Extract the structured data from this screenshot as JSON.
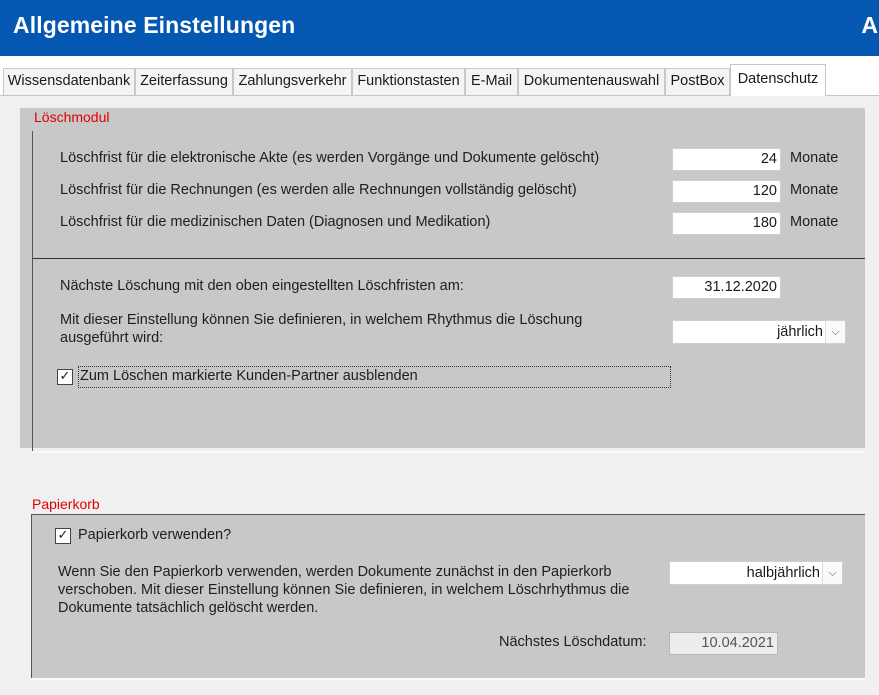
{
  "window": {
    "title": "Allgemeine Einstellungen",
    "title_edge": "A"
  },
  "tabs": [
    {
      "label": "Wissensdatenbank"
    },
    {
      "label": "Zeiterfassung"
    },
    {
      "label": "Zahlungsverkehr"
    },
    {
      "label": "Funktionstasten"
    },
    {
      "label": "E-Mail"
    },
    {
      "label": "Dokumentenauswahl"
    },
    {
      "label": "PostBox"
    },
    {
      "label": "Datenschutz",
      "active": true
    }
  ],
  "loeschmodul": {
    "title": "Löschmodul",
    "rows": [
      {
        "label": "Löschfrist für die elektronische Akte (es werden Vorgänge und Dokumente gelöscht)",
        "value": "24",
        "unit": "Monate"
      },
      {
        "label": "Löschfrist für die Rechnungen (es werden alle Rechnungen vollständig gelöscht)",
        "value": "120",
        "unit": "Monate"
      },
      {
        "label": "Löschfrist für die medizinischen Daten (Diagnosen und Medikation)",
        "value": "180",
        "unit": "Monate"
      }
    ],
    "next_label": "Nächste Löschung mit den oben eingestellten Löschfristen am:",
    "next_date": "31.12.2020",
    "rhythm_label": "Mit dieser Einstellung können Sie definieren, in welchem Rhythmus die Löschung ausgeführt wird:",
    "rhythm_value": "jährlich",
    "hide_label": "Zum Löschen markierte Kunden-Partner ausblenden",
    "hide_checked": "✓"
  },
  "papierkorb": {
    "title": "Papierkorb",
    "use_label": "Papierkorb verwenden?",
    "use_checked": "✓",
    "desc": "Wenn Sie den Papierkorb verwenden, werden Dokumente zunächst in den Papierkorb verschoben. Mit dieser Einstellung können Sie definieren, in welchem Löschrhythmus die Dokumente tatsächlich gelöscht werden.",
    "rhythm_value": "halbjährlich",
    "next_label": "Nächstes Löschdatum:",
    "next_date": "10.04.2021"
  },
  "icons": {
    "dropdown": "chevron-down-icon",
    "check": "checkmark-icon"
  },
  "colors": {
    "titlebar": "#0558b2",
    "group_title": "#e00000",
    "group_bg": "#c8c8c8"
  }
}
